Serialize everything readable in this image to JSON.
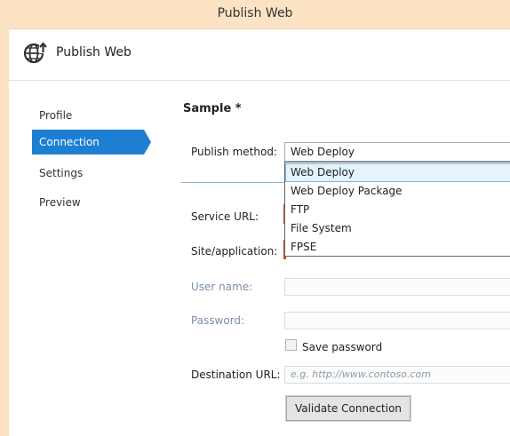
{
  "window": {
    "title": "Publish Web"
  },
  "header": {
    "title": "Publish Web",
    "icon": "globe-upload-icon"
  },
  "sidebar": {
    "items": [
      {
        "label": "Profile",
        "active": false
      },
      {
        "label": "Connection",
        "active": true
      },
      {
        "label": "Settings",
        "active": false
      },
      {
        "label": "Preview",
        "active": false
      }
    ]
  },
  "main": {
    "profile_name": "Sample *",
    "publish_method": {
      "label": "Publish method:",
      "value": "Web Deploy",
      "options": [
        "Web Deploy",
        "Web Deploy Package",
        "FTP",
        "File System",
        "FPSE"
      ],
      "highlighted": "Web Deploy"
    },
    "service_url": {
      "label": "Service URL:",
      "value": ""
    },
    "site_application": {
      "label": "Site/application:",
      "value": ""
    },
    "user_name": {
      "label": "User name:",
      "value": ""
    },
    "password": {
      "label": "Password:",
      "value": ""
    },
    "save_password": {
      "label": "Save password",
      "checked": false
    },
    "destination_url": {
      "label": "Destination URL:",
      "placeholder": "e.g. http://www.contoso.com"
    },
    "validate_button": "Validate Connection"
  },
  "colors": {
    "accent": "#1c7fd1",
    "title_bar": "#fce3c4",
    "error_edge": "#c94a2a"
  }
}
